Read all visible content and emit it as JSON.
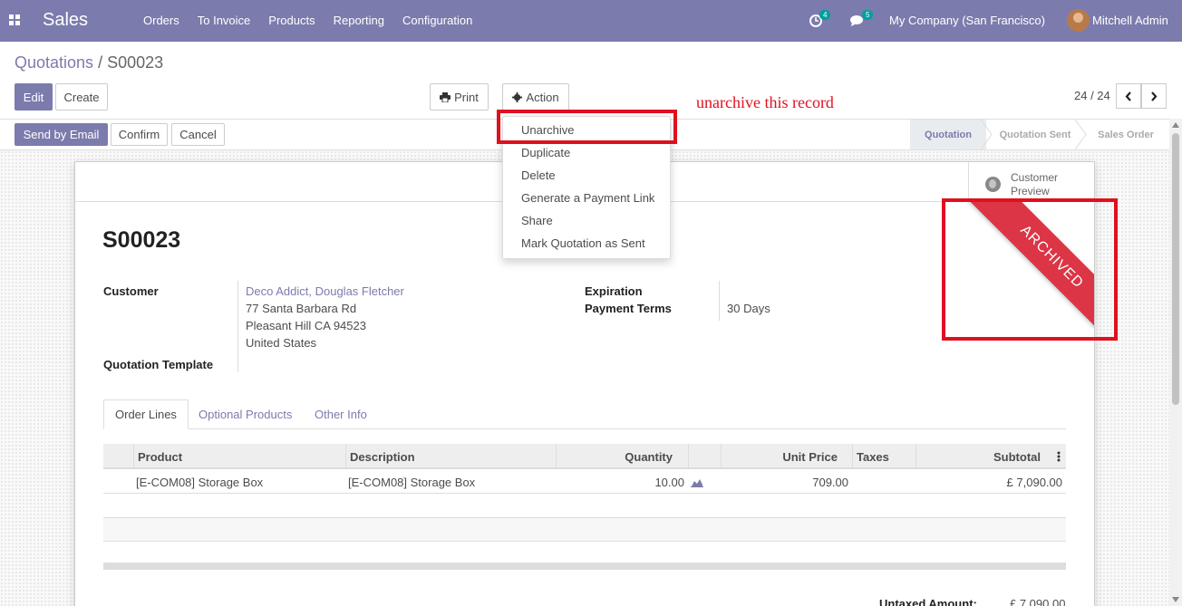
{
  "nav": {
    "app_name": "Sales",
    "menu": [
      "Orders",
      "To Invoice",
      "Products",
      "Reporting",
      "Configuration"
    ],
    "activity_count": "4",
    "message_count": "5",
    "company": "My Company (San Francisco)",
    "user": "Mitchell Admin"
  },
  "breadcrumb": {
    "parent": "Quotations",
    "separator": " / ",
    "current": "S00023"
  },
  "toolbar": {
    "edit": "Edit",
    "create": "Create",
    "print": "Print",
    "action": "Action",
    "pager": "24 / 24"
  },
  "statusbar": {
    "send_email": "Send by Email",
    "confirm": "Confirm",
    "cancel": "Cancel",
    "stages": [
      "Quotation",
      "Quotation Sent",
      "Sales Order"
    ]
  },
  "action_menu": {
    "items": [
      "Unarchive",
      "Duplicate",
      "Delete",
      "Generate a Payment Link",
      "Share",
      "Mark Quotation as Sent"
    ]
  },
  "annotation": "unarchive this record",
  "sheet": {
    "customer_preview": "Customer Preview",
    "ribbon": "ARCHIVED",
    "title": "S00023",
    "customer_label": "Customer",
    "customer_name": "Deco Addict, Douglas Fletcher",
    "address": [
      "77 Santa Barbara Rd",
      "Pleasant Hill CA 94523",
      "United States"
    ],
    "template_label": "Quotation Template",
    "expiration_label": "Expiration",
    "payment_terms_label": "Payment Terms",
    "payment_terms": "30 Days"
  },
  "tabs": [
    "Order Lines",
    "Optional Products",
    "Other Info"
  ],
  "order_lines": {
    "columns": [
      "Product",
      "Description",
      "Quantity",
      "Unit Price",
      "Taxes",
      "Subtotal"
    ],
    "rows": [
      {
        "product": "[E-COM08] Storage Box",
        "description": "[E-COM08] Storage Box",
        "quantity": "10.00",
        "unit_price": "709.00",
        "taxes": "",
        "subtotal": "£ 7,090.00"
      }
    ]
  },
  "totals": {
    "untaxed_label": "Untaxed Amount:",
    "untaxed_value": "£ 7,090.00"
  },
  "colors": {
    "brand": "#7c7bad",
    "ribbon": "#dc3545",
    "highlight": "#e0101f",
    "badge": "#00a09d"
  }
}
